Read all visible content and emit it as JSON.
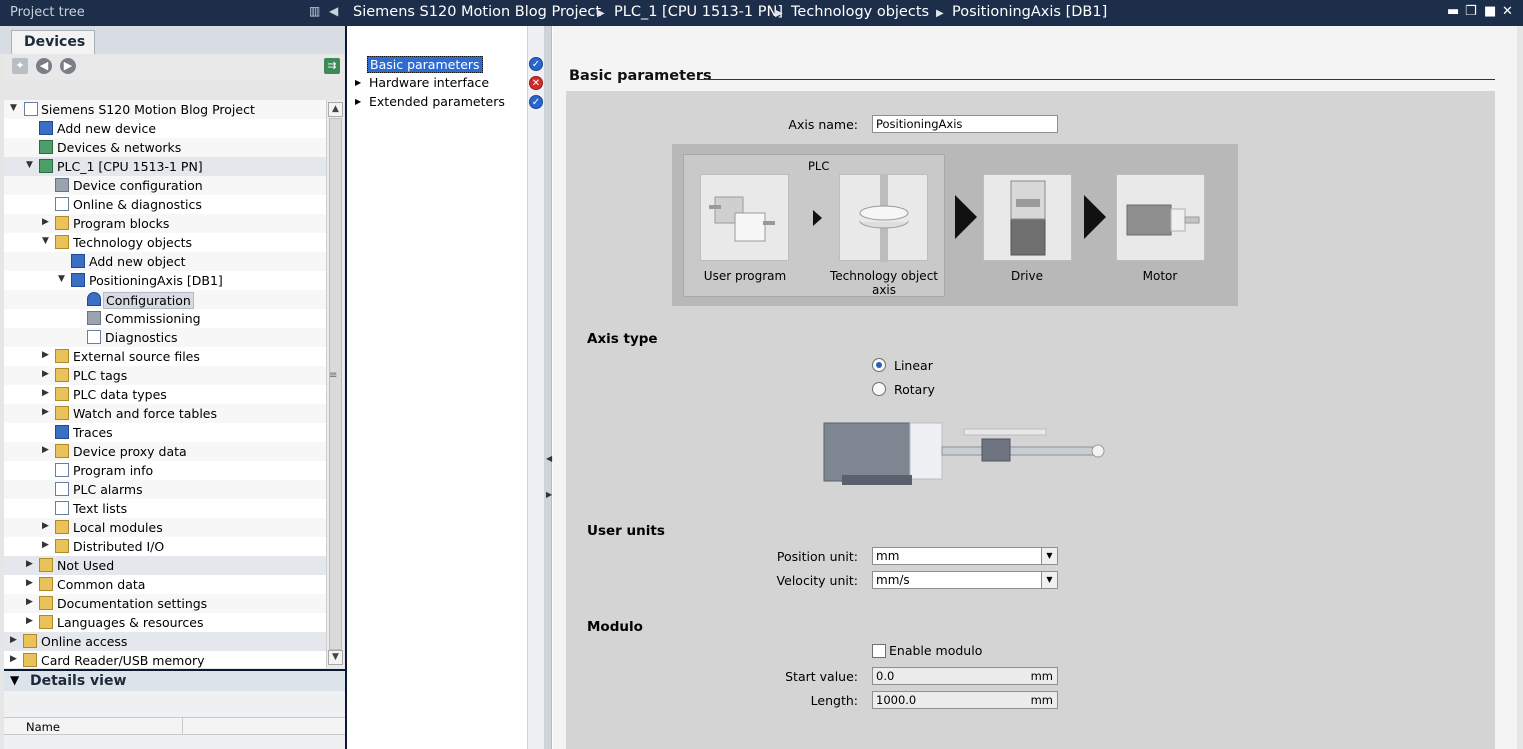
{
  "project_tree": {
    "title": "Project tree",
    "tab": "Devices",
    "items": [
      {
        "label": "Siemens S120 Motion Blog Project"
      },
      {
        "label": "Add new device"
      },
      {
        "label": "Devices & networks"
      },
      {
        "label": "PLC_1 [CPU 1513-1 PN]"
      },
      {
        "label": "Device configuration"
      },
      {
        "label": "Online & diagnostics"
      },
      {
        "label": "Program blocks"
      },
      {
        "label": "Technology objects"
      },
      {
        "label": "Add new object"
      },
      {
        "label": "PositioningAxis [DB1]"
      },
      {
        "label": "Configuration"
      },
      {
        "label": "Commissioning"
      },
      {
        "label": "Diagnostics"
      },
      {
        "label": "External source files"
      },
      {
        "label": "PLC tags"
      },
      {
        "label": "PLC data types"
      },
      {
        "label": "Watch and force tables"
      },
      {
        "label": "Traces"
      },
      {
        "label": "Device proxy data"
      },
      {
        "label": "Program info"
      },
      {
        "label": "PLC alarms"
      },
      {
        "label": "Text lists"
      },
      {
        "label": "Local modules"
      },
      {
        "label": "Distributed I/O"
      },
      {
        "label": "Not Used"
      },
      {
        "label": "Common data"
      },
      {
        "label": "Documentation settings"
      },
      {
        "label": "Languages & resources"
      },
      {
        "label": "Online access"
      },
      {
        "label": "Card Reader/USB memory"
      }
    ]
  },
  "details_view": {
    "title": "Details view",
    "column_name": "Name"
  },
  "breadcrumb": [
    "Siemens S120 Motion Blog Project",
    "PLC_1 [CPU 1513-1 PN]",
    "Technology objects",
    "PositioningAxis [DB1]"
  ],
  "nav": [
    {
      "label": "Basic parameters",
      "status": "ok"
    },
    {
      "label": "Hardware interface",
      "status": "error"
    },
    {
      "label": "Extended parameters",
      "status": "ok"
    }
  ],
  "basic": {
    "title": "Basic parameters",
    "axis_name_label": "Axis name:",
    "axis_name_value": "PositioningAxis",
    "diagram": {
      "plc_label": "PLC",
      "user_program": "User program",
      "tech_object": "Technology object axis",
      "drive": "Drive",
      "motor": "Motor"
    },
    "axis_type": {
      "title": "Axis type",
      "linear": "Linear",
      "rotary": "Rotary",
      "selected": "Linear"
    },
    "user_units": {
      "title": "User units",
      "position_label": "Position unit:",
      "position_value": "mm",
      "velocity_label": "Velocity unit:",
      "velocity_value": "mm/s"
    },
    "modulo": {
      "title": "Modulo",
      "enable_label": "Enable modulo",
      "enabled": false,
      "start_label": "Start value:",
      "start_value": "0.0",
      "start_unit": "mm",
      "length_label": "Length:",
      "length_value": "1000.0",
      "length_unit": "mm"
    }
  }
}
